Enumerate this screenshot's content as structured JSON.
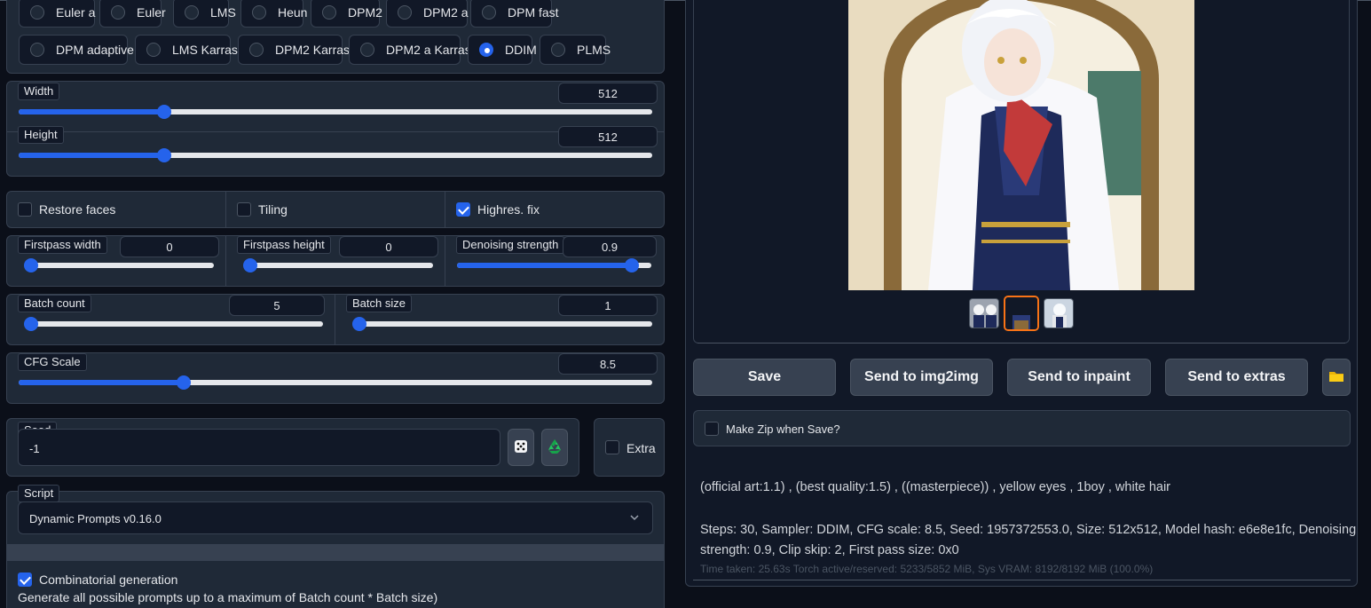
{
  "samplers": {
    "row1": [
      "Euler a",
      "Euler",
      "LMS",
      "Heun",
      "DPM2",
      "DPM2 a",
      "DPM fast"
    ],
    "row2": [
      "DPM adaptive",
      "LMS Karras",
      "DPM2 Karras",
      "DPM2 a Karras",
      "DDIM",
      "PLMS"
    ],
    "selected": "DDIM"
  },
  "size": {
    "width_label": "Width",
    "width_value": "512",
    "width_fraction": 0.23,
    "height_label": "Height",
    "height_value": "512",
    "height_fraction": 0.23
  },
  "options": {
    "restore_faces": "Restore faces",
    "restore_faces_checked": false,
    "tiling": "Tiling",
    "tiling_checked": false,
    "highres": "Highres. fix",
    "highres_checked": true
  },
  "highres": {
    "firstpass_width_label": "Firstpass width",
    "firstpass_width_value": "0",
    "firstpass_width_fraction": 0.0,
    "firstpass_height_label": "Firstpass height",
    "firstpass_height_value": "0",
    "firstpass_height_fraction": 0.0,
    "denoising_label": "Denoising strength",
    "denoising_value": "0.9",
    "denoising_fraction": 0.9
  },
  "batch": {
    "count_label": "Batch count",
    "count_value": "5",
    "count_fraction": 0.0,
    "size_label": "Batch size",
    "size_value": "1",
    "size_fraction": 0.0
  },
  "cfg": {
    "label": "CFG Scale",
    "value": "8.5",
    "fraction": 0.26
  },
  "seed": {
    "label": "Seed",
    "value": "-1",
    "extra_label": "Extra"
  },
  "script": {
    "label": "Script",
    "selected": "Dynamic Prompts v0.16.0",
    "combinatorial_label": "Combinatorial generation",
    "combinatorial_desc": "Generate all possible prompts up to a maximum of Batch count * Batch size)"
  },
  "output": {
    "buttons": [
      "Save",
      "Send to img2img",
      "Send to inpaint",
      "Send to extras"
    ],
    "make_zip_label": "Make Zip when Save?",
    "prompt_text": "(official art:1.1) , (best quality:1.5) , ((masterpiece)) , yellow eyes , 1boy , white hair",
    "params_text_line1": "Steps: 30, Sampler: DDIM, CFG scale: 8.5, Seed: 1957372553.0, Size: 512x512, Model hash: e6e8e1fc, Denoising",
    "params_text_line2": "strength: 0.9, Clip skip: 2, First pass size: 0x0",
    "time_text": "Time taken: 25.63s  Torch active/reserved: 5233/5852 MiB, Sys VRAM: 8192/8192 MiB (100.0%)"
  },
  "colors": {
    "accent": "#2563eb",
    "panel": "#1f2937",
    "background": "#0b0f19"
  }
}
